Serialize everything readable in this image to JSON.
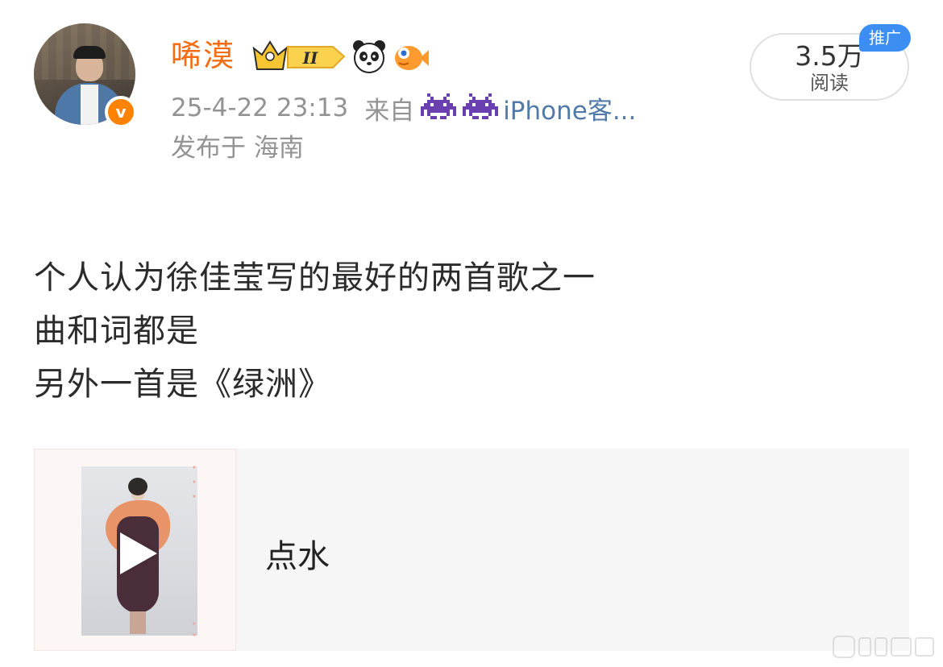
{
  "user": {
    "name": "唏漠",
    "badges": [
      "crown-level-badge",
      "panda-badge",
      "fish-badge"
    ],
    "badge_level_text": "II"
  },
  "meta": {
    "datetime": "25-4-22 23:13",
    "source_prefix": "来自",
    "source_app": "iPhone客...",
    "location": "发布于 海南"
  },
  "stats": {
    "read_count": "3.5万",
    "read_label": "阅读",
    "promo_tag": "推广"
  },
  "post": {
    "lines": [
      "个人认为徐佳莹写的最好的两首歌之一",
      "曲和词都是",
      "另外一首是《绿洲》"
    ]
  },
  "music_card": {
    "song_title": "点水"
  },
  "colors": {
    "username": "#f46d12",
    "verified": "#ff8200",
    "link": "#527aa8",
    "meta": "#939393",
    "promo": "#3c8ef2"
  }
}
